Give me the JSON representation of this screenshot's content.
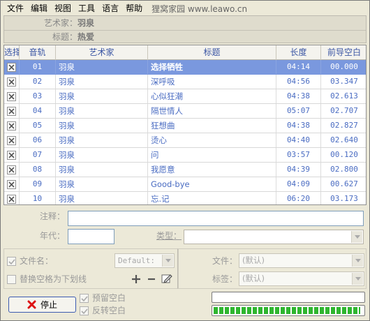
{
  "menu": [
    "文件",
    "编辑",
    "视图",
    "工具",
    "语言",
    "帮助"
  ],
  "brand": "狸窝家园 www.leawo.cn",
  "info": {
    "artist_label": "艺术家：",
    "artist_value": "羽泉",
    "title_label": "标题：",
    "title_value": "热爱"
  },
  "table": {
    "headers": [
      "选择",
      "音轨",
      "艺术家",
      "标题",
      "长度",
      "前导空白"
    ],
    "rows": [
      {
        "track": "01",
        "artist": "羽泉",
        "title": "选择牺牲",
        "length": "04:14",
        "gap": "00.000",
        "checked": true,
        "selected": true
      },
      {
        "track": "02",
        "artist": "羽泉",
        "title": "深呼吸",
        "length": "04:56",
        "gap": "03.347",
        "checked": true,
        "selected": false
      },
      {
        "track": "03",
        "artist": "羽泉",
        "title": "心似狂潮",
        "length": "04:38",
        "gap": "02.613",
        "checked": true,
        "selected": false
      },
      {
        "track": "04",
        "artist": "羽泉",
        "title": "隔世情人",
        "length": "05:07",
        "gap": "02.707",
        "checked": true,
        "selected": false
      },
      {
        "track": "05",
        "artist": "羽泉",
        "title": "狂想曲",
        "length": "04:38",
        "gap": "02.827",
        "checked": true,
        "selected": false
      },
      {
        "track": "06",
        "artist": "羽泉",
        "title": "烫心",
        "length": "04:40",
        "gap": "02.640",
        "checked": true,
        "selected": false
      },
      {
        "track": "07",
        "artist": "羽泉",
        "title": "问",
        "length": "03:57",
        "gap": "00.120",
        "checked": true,
        "selected": false
      },
      {
        "track": "08",
        "artist": "羽泉",
        "title": "我愿意",
        "length": "04:39",
        "gap": "02.800",
        "checked": true,
        "selected": false
      },
      {
        "track": "09",
        "artist": "羽泉",
        "title": "Good-bye",
        "length": "04:09",
        "gap": "00.627",
        "checked": true,
        "selected": false
      },
      {
        "track": "10",
        "artist": "羽泉",
        "title": "忘.记",
        "length": "06:20",
        "gap": "03.173",
        "checked": true,
        "selected": false
      }
    ]
  },
  "form": {
    "comment_label": "注释：",
    "comment_value": "",
    "year_label": "年代：",
    "year_value": "",
    "genre_label": "类型：",
    "genre_value": ""
  },
  "options": {
    "filename_label": "文件名：",
    "filename_checked": true,
    "filename_format": "Default:",
    "replace_space_label": "替换空格为下划线",
    "replace_space_checked": false,
    "file_label": "文件：",
    "file_value": "(默认)",
    "tag_label": "标签：",
    "tag_value": "(默认)"
  },
  "bottom": {
    "stop_label": "停止",
    "reserve_gap_label": "预留空白",
    "reserve_gap_checked": true,
    "reverse_gap_label": "反转空白",
    "reverse_gap_checked": true,
    "progress_track": 0,
    "progress_total": 0.98
  },
  "colors": {
    "accent": "#3a55a4",
    "selected_row": "#7a98de",
    "row_text": "#4a6cc2",
    "progress": "#2fb62f"
  }
}
